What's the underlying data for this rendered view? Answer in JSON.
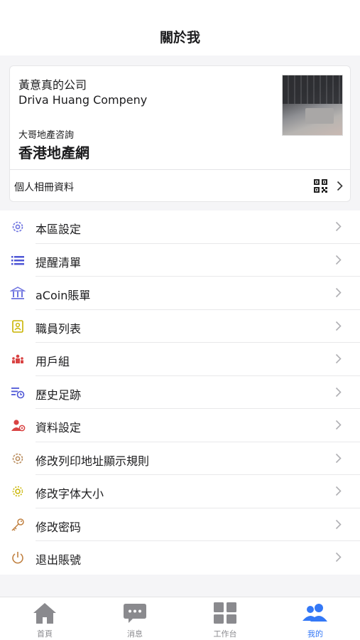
{
  "header": {
    "title": "關於我"
  },
  "profile": {
    "company_cn": "黃意真的公司",
    "company_en": "Driva Huang Compeny",
    "sub_label": "大哥地產咨詢",
    "agency_name": "香港地產網",
    "album_label": "個人相冊資料"
  },
  "menu": [
    {
      "label": "本區設定",
      "icon": "gear-icon",
      "color": "#6f74e0"
    },
    {
      "label": "提醒清單",
      "icon": "list-icon",
      "color": "#4f57d6"
    },
    {
      "label": "aCoin賬單",
      "icon": "bank-icon",
      "color": "#6f74e0"
    },
    {
      "label": "職員列表",
      "icon": "badge-icon",
      "color": "#c9b400"
    },
    {
      "label": "用戶組",
      "icon": "group-icon",
      "color": "#d94343"
    },
    {
      "label": "歷史足跡",
      "icon": "history-icon",
      "color": "#4f57d6"
    },
    {
      "label": "資料設定",
      "icon": "user-settings-icon",
      "color": "#d94343"
    },
    {
      "label": "修改列印地址顯示規則",
      "icon": "gear-outline-icon",
      "color": "#b88a5a"
    },
    {
      "label": "修改字体大小",
      "icon": "sun-gear-icon",
      "color": "#c9b400"
    },
    {
      "label": "修改密码",
      "icon": "key-icon",
      "color": "#c08040"
    },
    {
      "label": "退出賬號",
      "icon": "power-icon",
      "color": "#c08040"
    }
  ],
  "tabs": [
    {
      "label": "首頁",
      "icon": "home-icon",
      "active": false
    },
    {
      "label": "消息",
      "icon": "chat-icon",
      "active": false
    },
    {
      "label": "工作台",
      "icon": "grid-icon",
      "active": false
    },
    {
      "label": "我的",
      "icon": "people-icon",
      "active": true
    }
  ],
  "colors": {
    "accent": "#3478f6",
    "tab_inactive": "#8a8a8e"
  }
}
